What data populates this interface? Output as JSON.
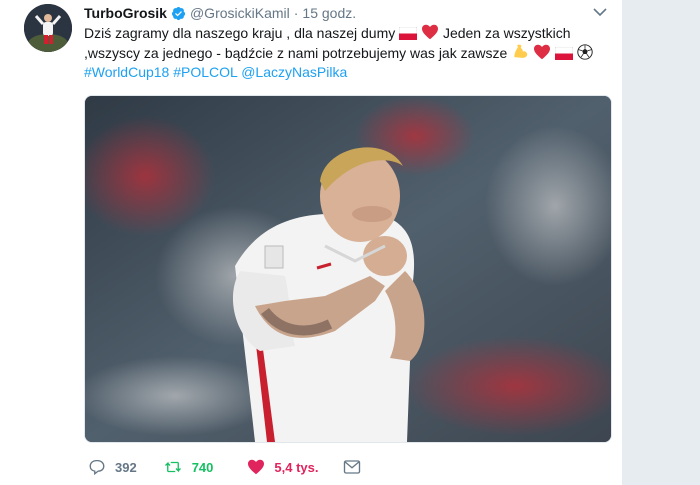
{
  "user": {
    "display_name": "TurboGrosik",
    "handle": "@GrosickiKamil",
    "separator": "·",
    "timestamp": "15 godz.",
    "verified": true
  },
  "tweet": {
    "line1": "Dziś zagramy dla naszego kraju , dla naszej dumy",
    "line1b": "Jeden za wszystkich",
    "line2": ",wszyscy za jednego - bądźcie z nami potrzebujemy was jak zawsze",
    "hashtags": [
      "#WorldCup18",
      "#POLCOL",
      "@LaczyNasPilka"
    ],
    "emojis": [
      "poland-flag",
      "red-heart",
      "flexed-biceps",
      "red-heart",
      "poland-flag",
      "soccer-ball"
    ]
  },
  "media": {
    "description_icon": "photo"
  },
  "actions": {
    "replies": "392",
    "retweets": "740",
    "likes": "5,4 tys."
  },
  "colors": {
    "link": "#1da1f2",
    "retweet": "#17bf63",
    "like": "#e0245e",
    "muted": "#657786",
    "text": "#14171a"
  }
}
